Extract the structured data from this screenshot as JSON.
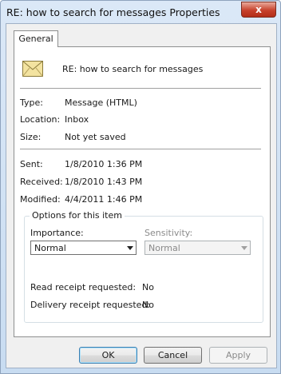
{
  "window": {
    "title": "RE: how to search for messages Properties",
    "close_glyph": "x"
  },
  "tabs": [
    {
      "label": "General"
    }
  ],
  "header": {
    "icon": "envelope-icon",
    "subject": "RE: how to search for messages"
  },
  "info": [
    {
      "label": "Type:",
      "value": "Message  (HTML)"
    },
    {
      "label": "Location:",
      "value": "Inbox"
    },
    {
      "label": "Size:",
      "value": "Not yet saved"
    }
  ],
  "dates": [
    {
      "label": "Sent:",
      "value": "1/8/2010  1:36 PM"
    },
    {
      "label": "Received:",
      "value": "1/8/2010  1:43 PM"
    },
    {
      "label": "Modified:",
      "value": "4/4/2011  1:46 PM"
    }
  ],
  "options": {
    "title": "Options for this item",
    "importance": {
      "label": "Importance:",
      "value": "Normal"
    },
    "sensitivity": {
      "label": "Sensitivity:",
      "value": "Normal"
    },
    "read_receipt": {
      "label": "Read receipt requested:",
      "value": "No"
    },
    "delivery_receipt": {
      "label": "Delivery receipt requested:",
      "value": "No"
    }
  },
  "buttons": {
    "ok": "OK",
    "cancel": "Cancel",
    "apply": "Apply"
  },
  "colors": {
    "accent": "#3c7fb1",
    "close": "#c7412b",
    "envelope": "#f3e3a0"
  }
}
